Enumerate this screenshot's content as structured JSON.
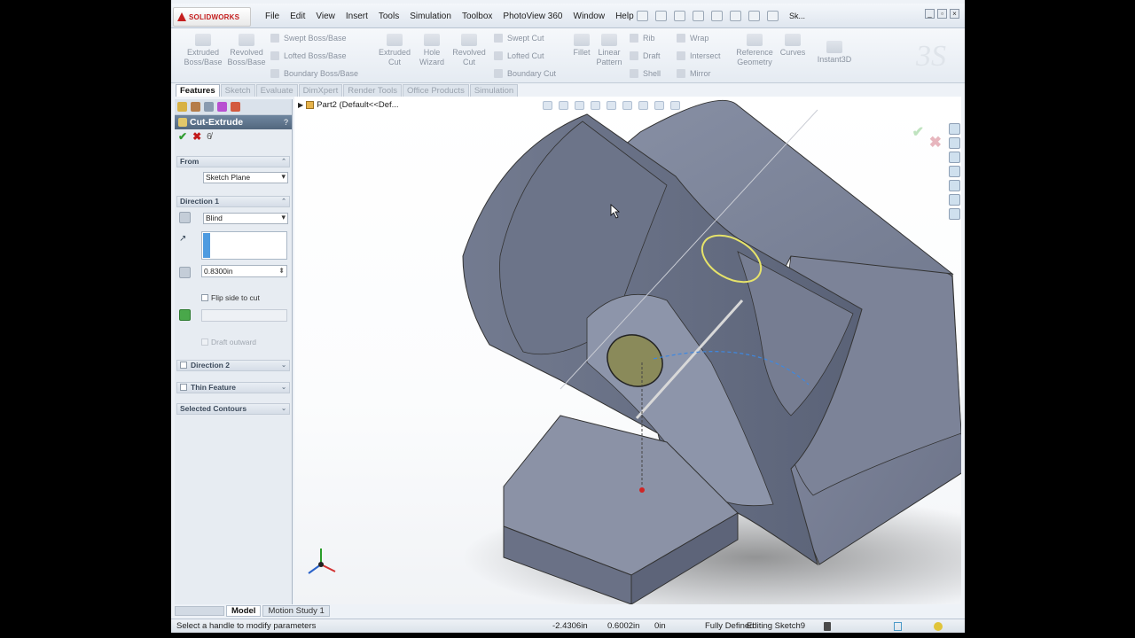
{
  "app": {
    "logo": "SOLIDWORKS"
  },
  "menu": [
    "File",
    "Edit",
    "View",
    "Insert",
    "Tools",
    "Simulation",
    "Toolbox",
    "PhotoView 360",
    "Window",
    "Help"
  ],
  "quick_search": "Sk...",
  "command_manager": {
    "extruded_boss": "Extruded\nBoss/Base",
    "revolved_boss": "Revolved\nBoss/Base",
    "swept_boss": "Swept Boss/Base",
    "lofted_boss": "Lofted Boss/Base",
    "boundary_boss": "Boundary Boss/Base",
    "extruded_cut": "Extruded\nCut",
    "hole_wizard": "Hole\nWizard",
    "revolved_cut": "Revolved\nCut",
    "swept_cut": "Swept Cut",
    "lofted_cut": "Lofted Cut",
    "boundary_cut": "Boundary Cut",
    "fillet": "Fillet",
    "linear_pattern": "Linear\nPattern",
    "rib": "Rib",
    "draft": "Draft",
    "shell": "Shell",
    "wrap": "Wrap",
    "intersect": "Intersect",
    "mirror": "Mirror",
    "reference_geometry": "Reference\nGeometry",
    "curves": "Curves",
    "instant3d": "Instant3D"
  },
  "tabs": [
    "Features",
    "Sketch",
    "Evaluate",
    "DimXpert",
    "Render Tools",
    "Office Products",
    "Simulation"
  ],
  "active_tab": "Features",
  "property_manager": {
    "title": "Cut-Extrude",
    "help": "? ",
    "from_label": "From",
    "from_value": "Sketch Plane",
    "direction1_label": "Direction 1",
    "end_condition": "Blind",
    "depth": "0.8300in",
    "flip_side": "Flip side to cut",
    "draft_outward": "Draft outward",
    "direction2_label": "Direction 2",
    "thin_feature_label": "Thin Feature",
    "selected_contours_label": "Selected Contours"
  },
  "tree": {
    "part": "Part2  (Default<<Def..."
  },
  "bottom_tabs": [
    "Model",
    "Motion Study 1"
  ],
  "active_bottom_tab": "Model",
  "status": {
    "message": "Select a handle to modify parameters",
    "x": "-2.4306in",
    "y": "0.6002in",
    "z": "0in",
    "state": "Fully Defined",
    "editing": "Editing Sketch9"
  }
}
